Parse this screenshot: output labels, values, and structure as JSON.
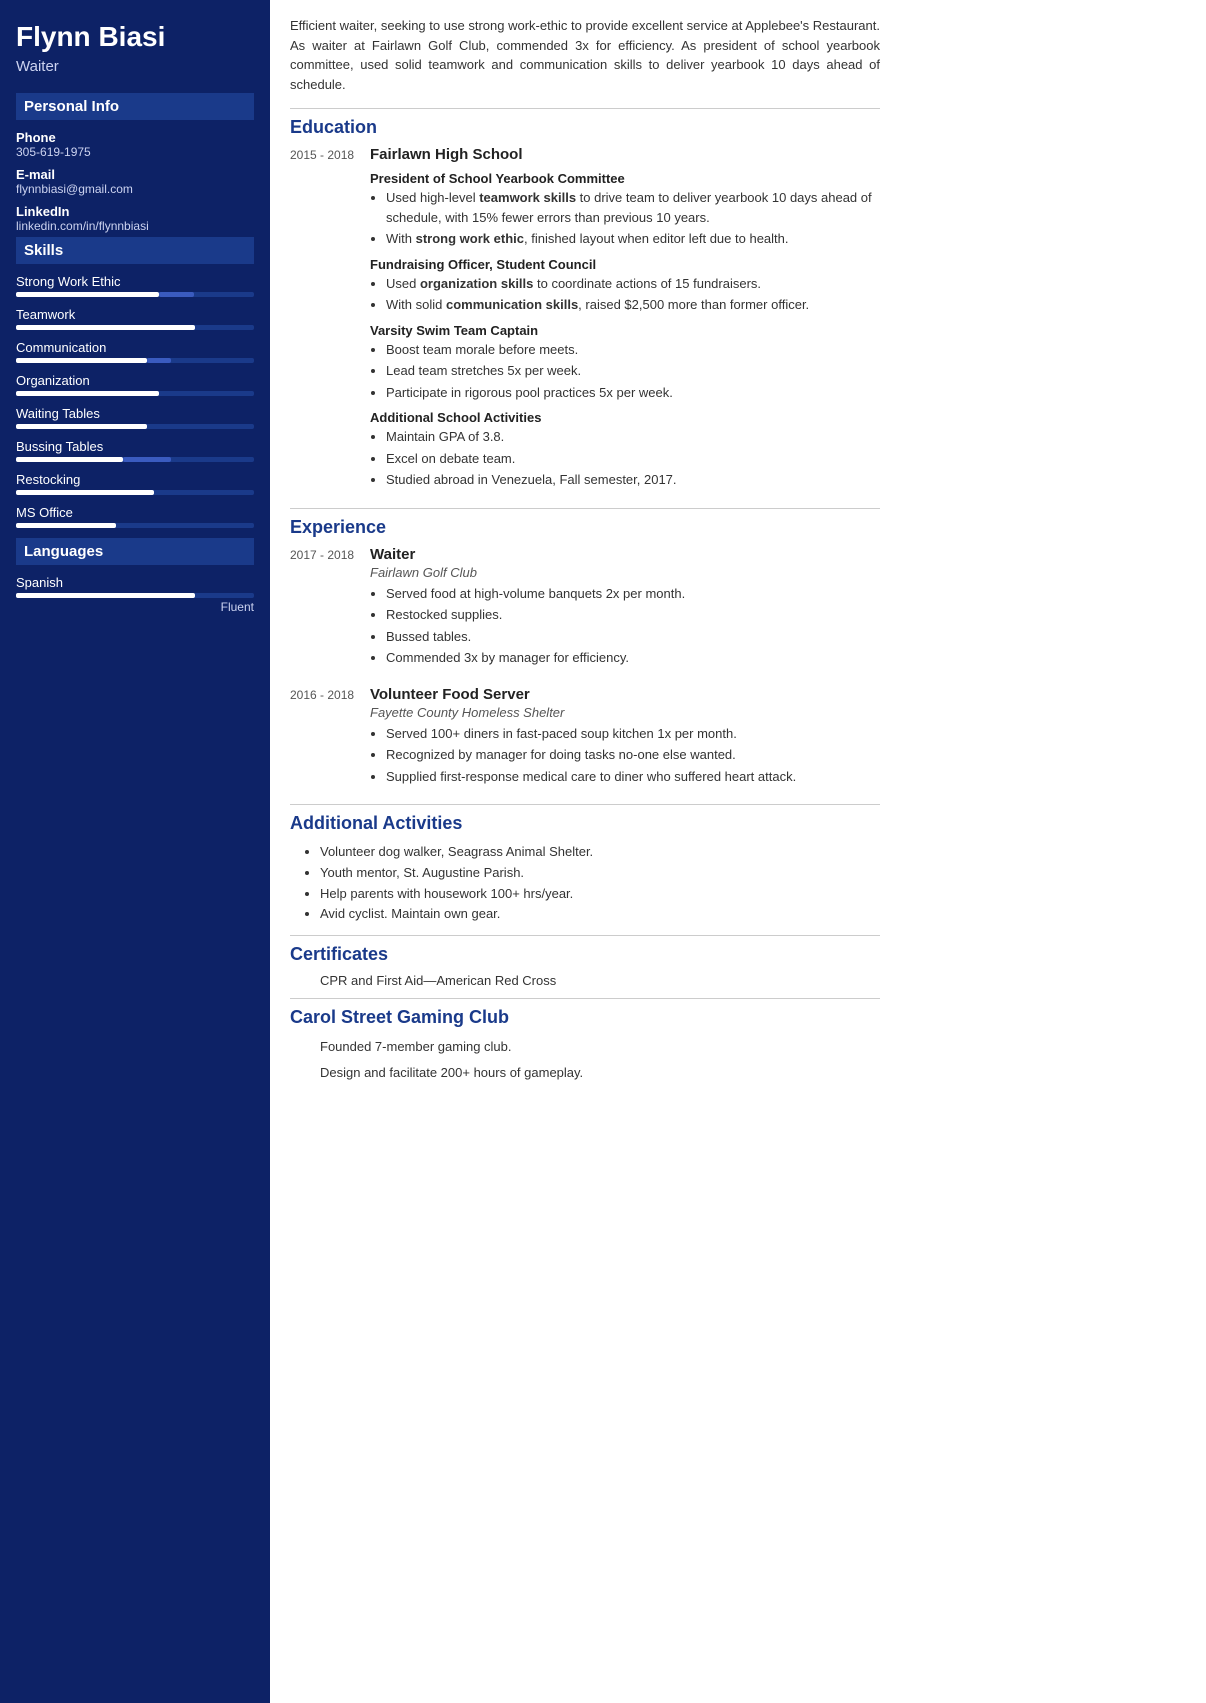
{
  "sidebar": {
    "name": "Flynn Biasi",
    "title": "Waiter",
    "sections": {
      "personal_info": "Personal Info",
      "skills": "Skills",
      "languages": "Languages"
    },
    "contact": {
      "phone_label": "Phone",
      "phone_value": "305-619-1975",
      "email_label": "E-mail",
      "email_value": "flynnbiasi@gmail.com",
      "linkedin_label": "LinkedIn",
      "linkedin_value": "linkedin.com/in/flynnbiasi"
    },
    "skills": [
      {
        "name": "Strong Work Ethic",
        "fill_pct": 60,
        "fill2_pct": 15
      },
      {
        "name": "Teamwork",
        "fill_pct": 75,
        "fill2_pct": 0
      },
      {
        "name": "Communication",
        "fill_pct": 55,
        "fill2_pct": 10
      },
      {
        "name": "Organization",
        "fill_pct": 60,
        "fill2_pct": 0
      },
      {
        "name": "Waiting Tables",
        "fill_pct": 55,
        "fill2_pct": 0
      },
      {
        "name": "Bussing Tables",
        "fill_pct": 45,
        "fill2_pct": 20
      },
      {
        "name": "Restocking",
        "fill_pct": 58,
        "fill2_pct": 0
      },
      {
        "name": "MS Office",
        "fill_pct": 42,
        "fill2_pct": 0
      }
    ],
    "languages": [
      {
        "name": "Spanish",
        "fill_pct": 75,
        "level": "Fluent"
      }
    ]
  },
  "main": {
    "summary": "Efficient waiter, seeking to use strong work-ethic to provide excellent service at Applebee's Restaurant. As waiter at Fairlawn Golf Club, commended 3x for efficiency. As president of school yearbook committee, used solid teamwork and communication skills to deliver yearbook 10 days ahead of schedule.",
    "education_title": "Education",
    "education": [
      {
        "date": "2015 - 2018",
        "org": "Fairlawn High School",
        "roles": [
          {
            "role": "President of School Yearbook Committee",
            "bullets": [
              "Used high-level teamwork skills to drive team to deliver yearbook 10 days ahead of schedule, with 15% fewer errors than previous 10 years.",
              "With strong work ethic, finished layout when editor left due to health."
            ]
          },
          {
            "role": "Fundraising Officer, Student Council",
            "bullets": [
              "Used organization skills to coordinate actions of 15 fundraisers.",
              "With solid communication skills, raised $2,500 more than former officer."
            ]
          },
          {
            "role": "Varsity Swim Team Captain",
            "bullets": [
              "Boost team morale before meets.",
              "Lead team stretches 5x per week.",
              "Participate in rigorous pool practices 5x per week."
            ]
          },
          {
            "role": "Additional School Activities",
            "bullets": [
              "Maintain GPA of 3.8.",
              "Excel on debate team.",
              "Studied abroad in Venezuela, Fall semester, 2017."
            ]
          }
        ]
      }
    ],
    "experience_title": "Experience",
    "experience": [
      {
        "date": "2017 - 2018",
        "org": "Waiter",
        "suborg": "Fairlawn Golf Club",
        "bullets": [
          "Served food at high-volume banquets 2x per month.",
          "Restocked supplies.",
          "Bussed tables.",
          "Commended 3x by manager for efficiency."
        ]
      },
      {
        "date": "2016 - 2018",
        "org": "Volunteer Food Server",
        "suborg": "Fayette County Homeless Shelter",
        "bullets": [
          "Served 100+ diners in fast-paced soup kitchen 1x per month.",
          "Recognized by manager for doing tasks no-one else wanted.",
          "Supplied first-response medical care to diner who suffered heart attack."
        ]
      }
    ],
    "additional_title": "Additional Activities",
    "additional_items": [
      "Volunteer dog walker, Seagrass Animal Shelter.",
      "Youth mentor, St. Augustine Parish.",
      "Help parents with housework 100+ hrs/year.",
      "Avid cyclist. Maintain own gear."
    ],
    "certificates_title": "Certificates",
    "certificates_text": "CPR and First Aid—American Red Cross",
    "gaming_title": "Carol Street Gaming Club",
    "gaming_items": [
      "Founded 7-member gaming club.",
      "Design and facilitate 200+ hours of gameplay."
    ]
  }
}
